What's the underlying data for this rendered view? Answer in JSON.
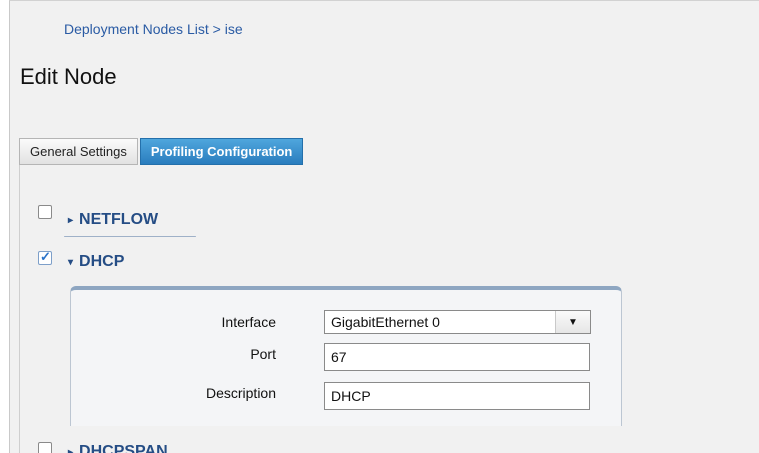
{
  "breadcrumb": {
    "link": "Deployment Nodes List",
    "separator": " > ",
    "current": "ise"
  },
  "page": {
    "title": "Edit Node"
  },
  "tabs": [
    {
      "label": "General Settings",
      "active": false
    },
    {
      "label": "Profiling Configuration",
      "active": true
    }
  ],
  "sections": {
    "netflow": {
      "label": "NETFLOW",
      "checked": false,
      "expanded": false
    },
    "dhcp": {
      "label": "DHCP",
      "checked": true,
      "expanded": true
    },
    "dhcpspan": {
      "label": "DHCPSPAN",
      "checked": false,
      "expanded": false
    }
  },
  "dhcp_form": {
    "interface_label": "Interface",
    "interface_value": "GigabitEthernet 0",
    "port_label": "Port",
    "port_value": "67",
    "description_label": "Description",
    "description_value": "DHCP"
  },
  "icons": {
    "collapsed_caret": "▸",
    "expanded_caret": "▾",
    "dropdown_arrow": "▼",
    "check": "✓"
  },
  "colors": {
    "active_tab": "#2a7dbe",
    "section_header": "#254d85",
    "link": "#2a5ba4"
  }
}
